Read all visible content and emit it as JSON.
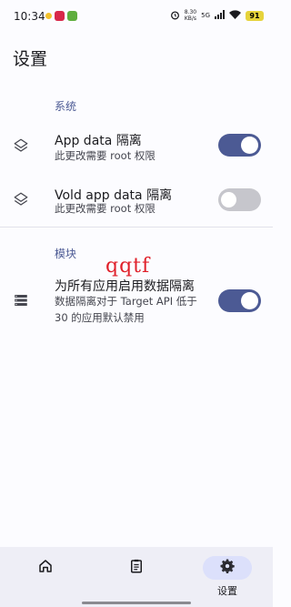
{
  "status_bar": {
    "time": "10:34",
    "net_speed_value": "8.30",
    "net_speed_unit": "KB/s",
    "network": "5G",
    "battery": "91"
  },
  "page": {
    "title": "设置"
  },
  "sections": [
    {
      "header": "系统",
      "items": [
        {
          "title": "App data 隔离",
          "subtitle": "此更改需要 root 权限",
          "enabled": true,
          "icon": "layers-icon"
        },
        {
          "title": "Vold app data 隔离",
          "subtitle": "此更改需要 root 权限",
          "enabled": false,
          "icon": "layers-icon"
        }
      ]
    },
    {
      "header": "模块",
      "items": [
        {
          "title": "为所有应用启用数据隔离",
          "subtitle": "数据隔离对于 Target API 低于 30 的应用默认禁用",
          "enabled": true,
          "icon": "storage-icon"
        }
      ]
    }
  ],
  "watermark": "qqtf",
  "bottom_nav": [
    {
      "label": "",
      "icon": "home-icon",
      "active": false
    },
    {
      "label": "",
      "icon": "clipboard-icon",
      "active": false
    },
    {
      "label": "设置",
      "icon": "gear-icon",
      "active": true
    }
  ],
  "colors": {
    "accent": "#4c5a94",
    "switch_off": "#c6c6cc",
    "background": "#fcfcff",
    "nav_background": "#eeeef6",
    "nav_active_pill": "#dce0fb",
    "watermark": "#e0202a"
  }
}
